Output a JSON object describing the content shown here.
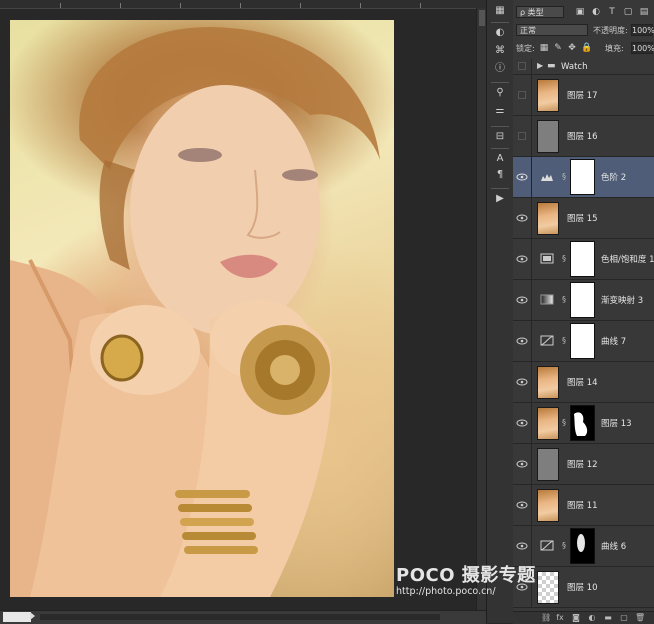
{
  "panel": {
    "filter_kind": "ρ 类型",
    "blend_mode": "正常",
    "opacity_label": "不透明度:",
    "opacity_value": "100%",
    "lock_label": "锁定:",
    "fill_label": "填充:",
    "fill_value": "100%"
  },
  "group": {
    "name": "Watch"
  },
  "layers": [
    {
      "name": "图层 17",
      "visible": false
    },
    {
      "name": "图层 16",
      "visible": false
    },
    {
      "name": "色阶 2",
      "visible": true,
      "selected": true
    },
    {
      "name": "图层 15",
      "visible": true
    },
    {
      "name": "色相/饱和度 1",
      "visible": true
    },
    {
      "name": "渐变映射 3",
      "visible": true
    },
    {
      "name": "曲线 7",
      "visible": true
    },
    {
      "name": "图层 14",
      "visible": true
    },
    {
      "name": "图层 13",
      "visible": true
    },
    {
      "name": "图层 12",
      "visible": true
    },
    {
      "name": "图层 11",
      "visible": true
    },
    {
      "name": "曲线 6",
      "visible": true
    },
    {
      "name": "图层 10",
      "visible": true
    }
  ],
  "watermark": {
    "brand": "POCO 摄影专题",
    "url": "http://photo.poco.cn/"
  },
  "icons": {
    "eye": "eye-icon",
    "folder": "folder-icon",
    "chain": "chain-link-icon",
    "levels": "levels-adjustment-icon",
    "hue_sat": "hue-saturation-icon",
    "gradient_map": "gradient-map-icon",
    "curves": "curves-icon"
  }
}
